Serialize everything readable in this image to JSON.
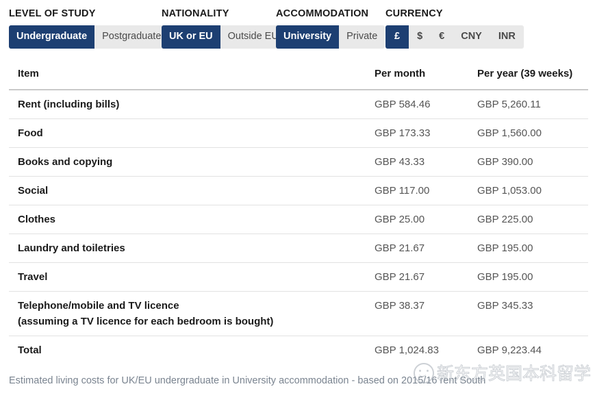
{
  "filters": [
    {
      "name": "level-of-study",
      "label": "LEVEL OF STUDY",
      "options": [
        {
          "label": "Undergraduate",
          "active": true
        },
        {
          "label": "Postgraduate",
          "active": false
        }
      ]
    },
    {
      "name": "nationality",
      "label": "NATIONALITY",
      "options": [
        {
          "label": "UK or EU",
          "active": true
        },
        {
          "label": "Outside EU",
          "active": false
        }
      ]
    },
    {
      "name": "accommodation",
      "label": "ACCOMMODATION",
      "options": [
        {
          "label": "University",
          "active": true
        },
        {
          "label": "Private",
          "active": false
        }
      ]
    },
    {
      "name": "currency",
      "label": "CURRENCY",
      "options": [
        {
          "label": "£",
          "active": true
        },
        {
          "label": "$",
          "active": false
        },
        {
          "label": "€",
          "active": false
        },
        {
          "label": "CNY",
          "active": false
        },
        {
          "label": "INR",
          "active": false
        }
      ]
    }
  ],
  "table": {
    "headers": {
      "item": "Item",
      "per_month": "Per month",
      "per_year": "Per year (39 weeks)"
    },
    "rows": [
      {
        "item": "Rent (including bills)",
        "note": "",
        "per_month": "GBP 584.46",
        "per_year": "GBP 5,260.11"
      },
      {
        "item": "Food",
        "note": "",
        "per_month": "GBP 173.33",
        "per_year": "GBP 1,560.00"
      },
      {
        "item": "Books and copying",
        "note": "",
        "per_month": "GBP 43.33",
        "per_year": "GBP 390.00"
      },
      {
        "item": "Social",
        "note": "",
        "per_month": "GBP 117.00",
        "per_year": "GBP 1,053.00"
      },
      {
        "item": "Clothes",
        "note": "",
        "per_month": "GBP 25.00",
        "per_year": "GBP 225.00"
      },
      {
        "item": "Laundry and toiletries",
        "note": "",
        "per_month": "GBP 21.67",
        "per_year": "GBP 195.00"
      },
      {
        "item": "Travel",
        "note": "",
        "per_month": "GBP 21.67",
        "per_year": "GBP 195.00"
      },
      {
        "item": "Telephone/mobile and TV licence",
        "note": "(assuming a TV licence for each bedroom is bought)",
        "per_month": "GBP 38.37",
        "per_year": "GBP 345.33"
      },
      {
        "item": "Total",
        "note": "",
        "per_month": "GBP 1,024.83",
        "per_year": "GBP 9,223.44",
        "total": true
      }
    ]
  },
  "footnote": "Estimated living costs for UK/EU undergraduate in University accommodation - based on 2015/16 rent South",
  "watermark": {
    "text": "新东方英国本科留学"
  },
  "colors": {
    "accent": "#1d3f72",
    "segment_bg": "#e9e9e9",
    "footnote": "#7a8490"
  }
}
